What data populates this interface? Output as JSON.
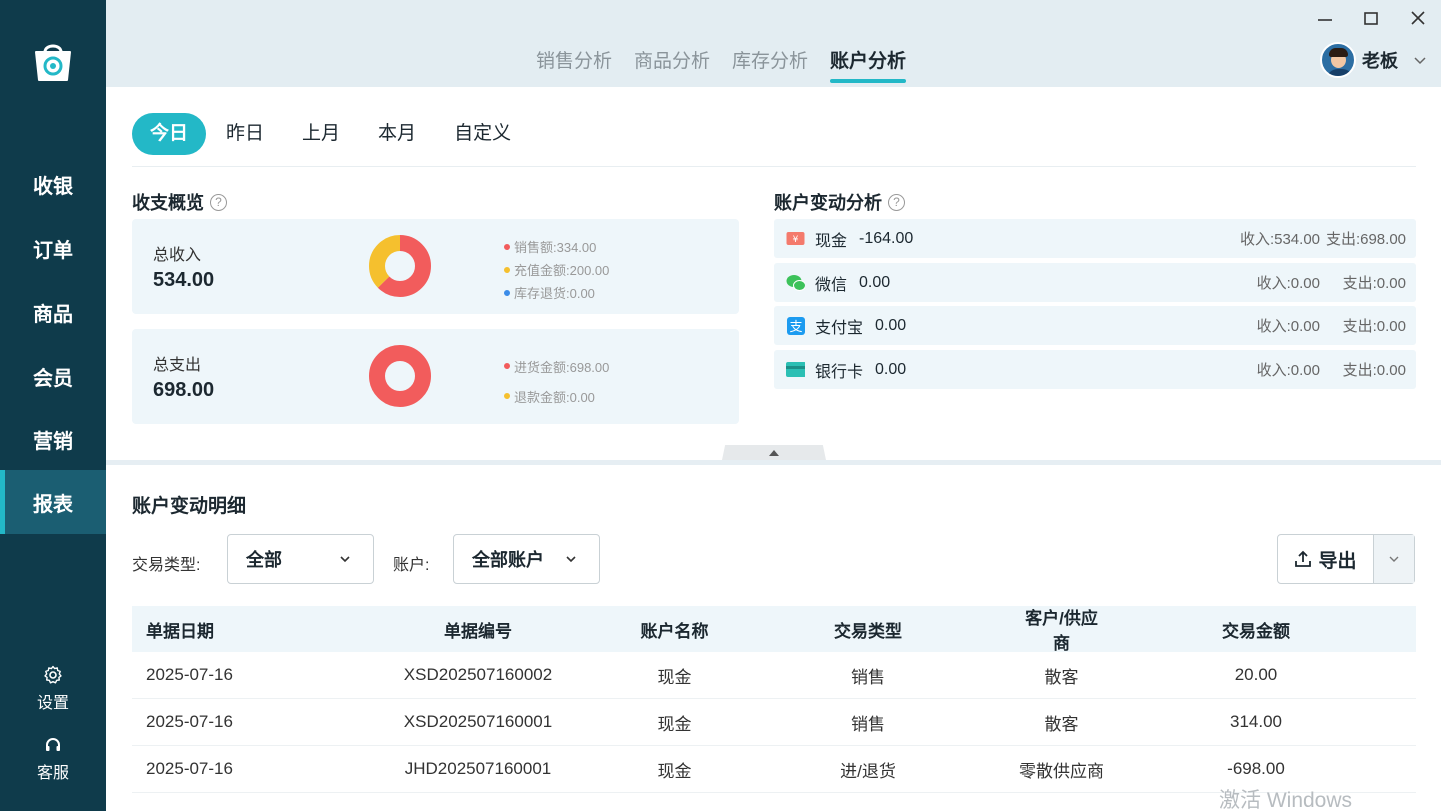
{
  "sidebar": {
    "items": [
      {
        "label": "收银"
      },
      {
        "label": "订单"
      },
      {
        "label": "商品"
      },
      {
        "label": "会员"
      },
      {
        "label": "营销"
      },
      {
        "label": "报表",
        "active": true
      }
    ],
    "settings_label": "设置",
    "service_label": "客服"
  },
  "header": {
    "tabs": [
      {
        "label": "销售分析"
      },
      {
        "label": "商品分析"
      },
      {
        "label": "库存分析"
      },
      {
        "label": "账户分析",
        "active": true
      }
    ],
    "user_name": "老板"
  },
  "period_filter": {
    "options": [
      "今日",
      "昨日",
      "上月",
      "本月",
      "自定义"
    ],
    "selected": "今日"
  },
  "overview": {
    "title": "收支概览",
    "income": {
      "label": "总收入",
      "value": "534.00",
      "legend": [
        {
          "label": "销售额:334.00",
          "value": 334.0,
          "color": "#f25c5c"
        },
        {
          "label": "充值金额:200.00",
          "value": 200.0,
          "color": "#f5c02e"
        },
        {
          "label": "库存退货:0.00",
          "value": 0.0,
          "color": "#3b8ce8"
        }
      ]
    },
    "expense": {
      "label": "总支出",
      "value": "698.00",
      "legend": [
        {
          "label": "进货金额:698.00",
          "value": 698.0,
          "color": "#f25c5c"
        },
        {
          "label": "退款金额:0.00",
          "value": 0.0,
          "color": "#f5c02e"
        }
      ]
    }
  },
  "account_changes": {
    "title": "账户变动分析",
    "accounts": [
      {
        "name": "现金",
        "balance": "-164.00",
        "income": "收入:534.00",
        "expense": "支出:698.00",
        "icon": "cash-icon"
      },
      {
        "name": "微信",
        "balance": "0.00",
        "income": "收入:0.00",
        "expense": "支出:0.00",
        "icon": "wechat-icon"
      },
      {
        "name": "支付宝",
        "balance": "0.00",
        "income": "收入:0.00",
        "expense": "支出:0.00",
        "icon": "alipay-icon"
      },
      {
        "name": "银行卡",
        "balance": "0.00",
        "income": "收入:0.00",
        "expense": "支出:0.00",
        "icon": "bank-card-icon"
      }
    ]
  },
  "details": {
    "title": "账户变动明细",
    "filters": {
      "type_label": "交易类型:",
      "type_value": "全部",
      "account_label": "账户:",
      "account_value": "全部账户"
    },
    "export_label": "导出",
    "columns": [
      "单据日期",
      "单据编号",
      "账户名称",
      "交易类型",
      "客户/供应商",
      "交易金额"
    ],
    "rows": [
      [
        "2025-07-16",
        "XSD202507160002",
        "现金",
        "销售",
        "散客",
        "20.00"
      ],
      [
        "2025-07-16",
        "XSD202507160001",
        "现金",
        "销售",
        "散客",
        "314.00"
      ],
      [
        "2025-07-16",
        "JHD202507160001",
        "现金",
        "进/退货",
        "零散供应商",
        "-698.00"
      ]
    ]
  },
  "watermark": "激活 Windows",
  "colors": {
    "sidebar_bg": "#0f3b4b",
    "accent": "#23b8c7",
    "red": "#f25c5c",
    "yellow": "#f5c02e",
    "blue": "#3b8ce8"
  }
}
